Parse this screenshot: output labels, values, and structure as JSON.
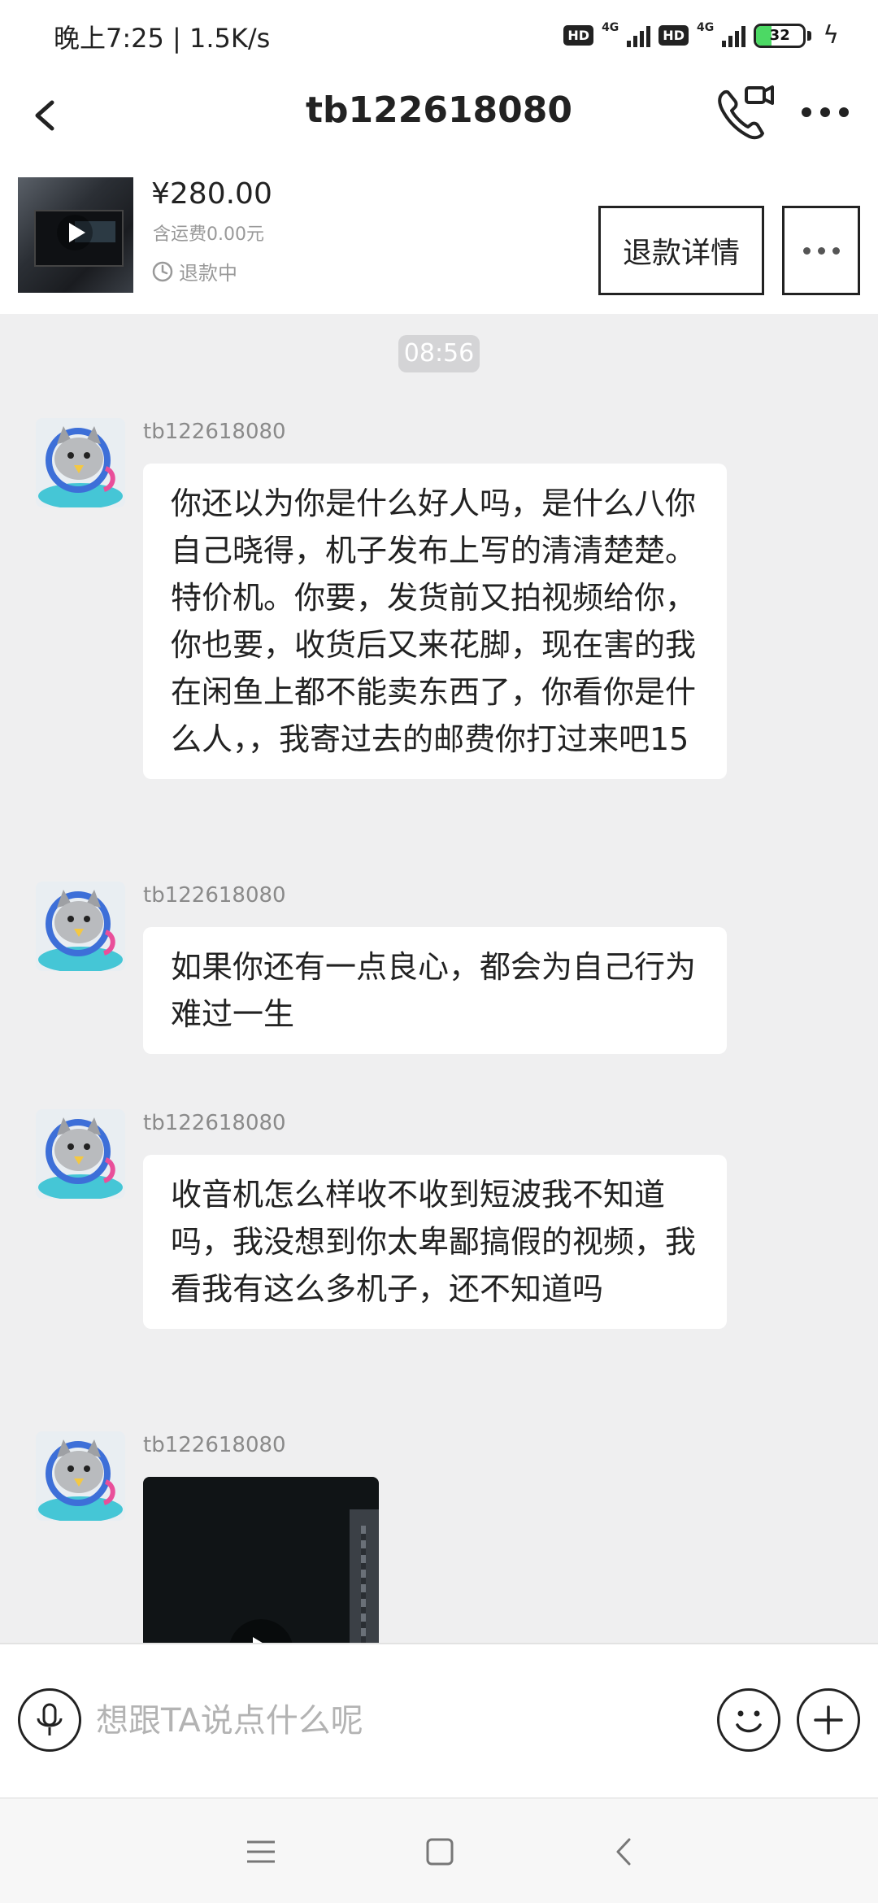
{
  "status_bar": {
    "time_speed": "晚上7:25 | 1.5K/s",
    "hd_badge": "HD",
    "network": "4G",
    "battery_level": "32",
    "battery_fraction": 0.32
  },
  "header": {
    "title": "tb122618080",
    "icons": {
      "back": "chevron-left-icon",
      "call": "phone-video-icon",
      "more": "more-dots-icon"
    }
  },
  "order": {
    "price": "¥280.00",
    "shipping": "含运费0.00元",
    "status": "退款中",
    "refund_button": "退款详情"
  },
  "chat": {
    "timestamp": "08:56",
    "messages": [
      {
        "sender": "tb122618080",
        "text": "你还以为你是什么好人吗，是什么八你自己晓得，机子发布上写的清清楚楚。特价机。你要，发货前又拍视频给你，你也要，收货后又来花脚，现在害的我在闲鱼上都不能卖东西了，你看你是什么人，，我寄过去的邮费你打过来吧15"
      },
      {
        "sender": "tb122618080",
        "text": "如果你还有一点良心，都会为自己行为难过一生"
      },
      {
        "sender": "tb122618080",
        "text": "收音机怎么样收不收到短波我不知道吗，我没想到你太卑鄙搞假的视频，我看我有这么多机子，还不知道吗"
      },
      {
        "sender": "tb122618080",
        "type": "video"
      }
    ]
  },
  "input_bar": {
    "placeholder": "想跟TA说点什么呢",
    "value": "",
    "icons": {
      "voice": "microphone-icon",
      "emoji": "smiley-icon",
      "plus": "plus-icon"
    }
  },
  "nav_bar": {
    "icons": [
      "menu-icon",
      "home-square-icon",
      "back-arrow-icon"
    ]
  },
  "colors": {
    "chat_background": "#efeff0",
    "bubble": "#ffffff",
    "timestamp_chip": "#d4d4d6",
    "battery_fill": "#4cd964"
  }
}
